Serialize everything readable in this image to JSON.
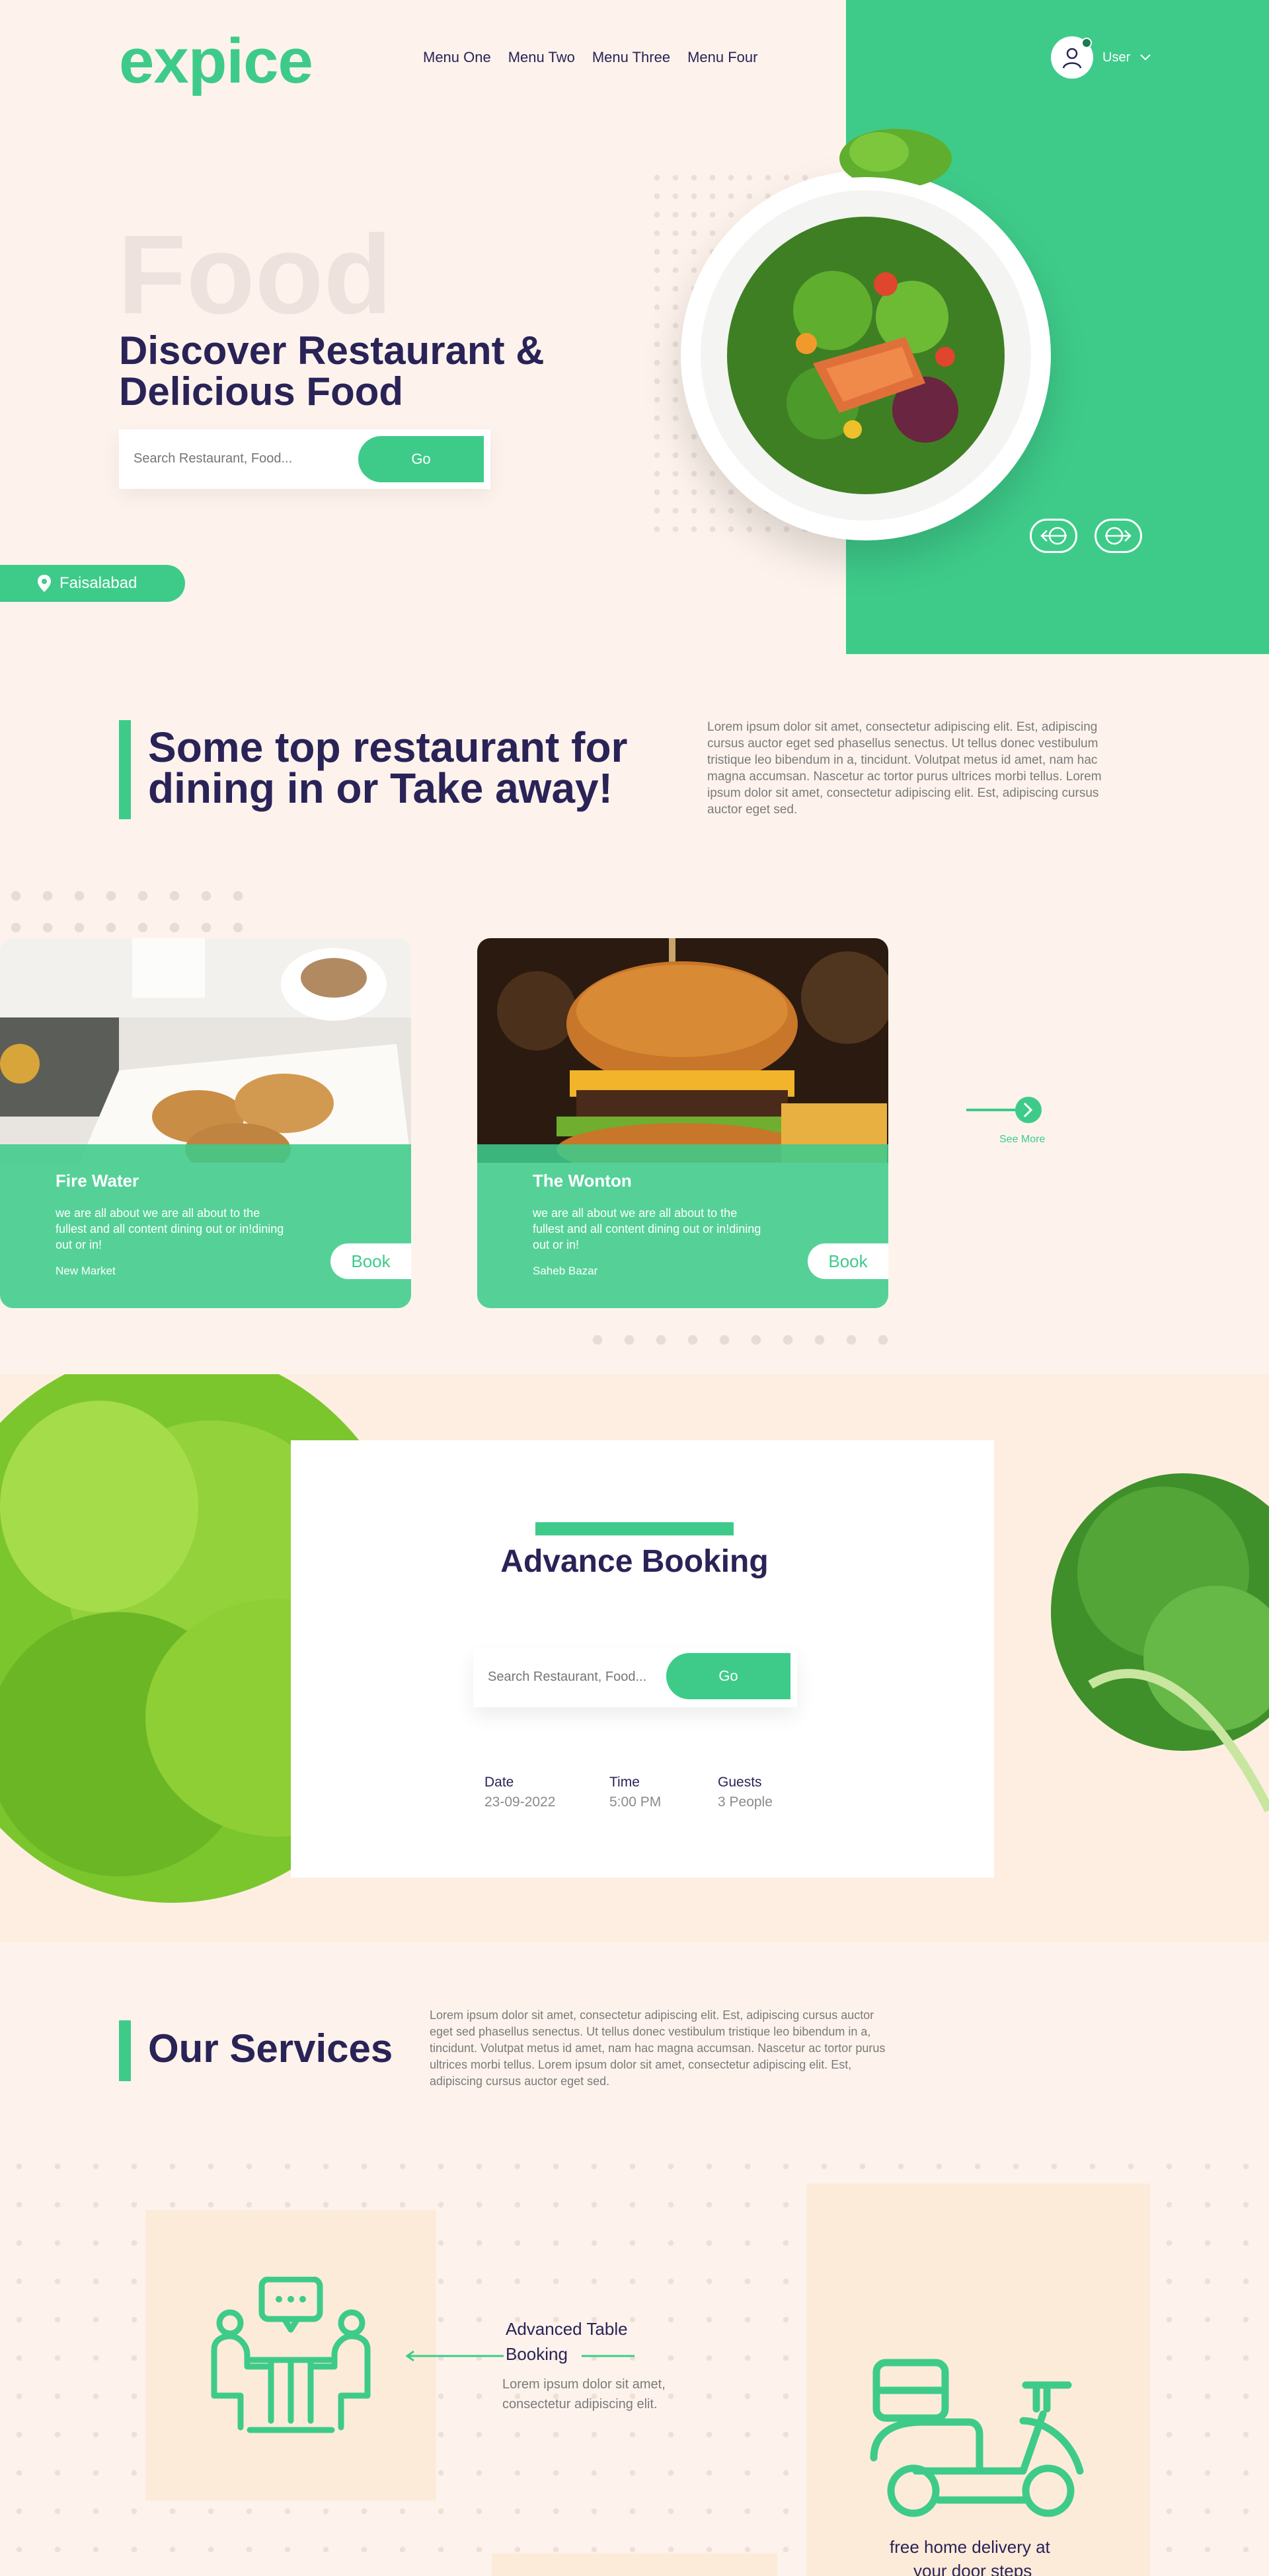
{
  "header": {
    "logo": "expice",
    "nav": [
      "Menu One",
      "Menu Two",
      "Menu Three",
      "Menu Four"
    ],
    "user_label": "User"
  },
  "hero": {
    "bg_word": "Food",
    "title": "Discover Restaurant & Delicious Food",
    "search_placeholder": "Search Restaurant, Food...",
    "go_label": "Go",
    "location": "Faisalabad"
  },
  "top": {
    "title": "Some top restaurant for dining in or Take away!",
    "description": "Lorem ipsum dolor sit amet, consectetur adipiscing elit. Est, adipiscing cursus auctor eget sed phasellus senectus. Ut tellus donec vestibulum tristique leo bibendum in a, tincidunt. Volutpat metus id amet, nam hac magna accumsan. Nascetur ac tortor purus ultrices morbi tellus. Lorem ipsum dolor sit amet, consectetur adipiscing elit. Est, adipiscing cursus auctor eget sed.",
    "cards": [
      {
        "name": "Fire Water",
        "description": "we are all about we are all about to the fullest and all content dining out or in!dining out or in!",
        "location": "New Market",
        "book_label": "Book"
      },
      {
        "name": "The Wonton",
        "description": "we are all about we are all about to the fullest and all content dining out or in!dining out or in!",
        "location": "Saheb Bazar",
        "book_label": "Book"
      }
    ],
    "see_more": "See More"
  },
  "booking": {
    "title": "Advance Booking",
    "search_placeholder": "Search Restaurant, Food...",
    "go_label": "Go",
    "fields": [
      {
        "label": "Date",
        "value": "23-09-2022"
      },
      {
        "label": "Time",
        "value": "5:00 PM"
      },
      {
        "label": "Guests",
        "value": "3 People"
      }
    ]
  },
  "services": {
    "title": "Our Services",
    "description": "Lorem ipsum dolor sit amet, consectetur adipiscing elit. Est, adipiscing cursus auctor eget sed phasellus senectus. Ut tellus donec vestibulum tristique leo bibendum in a, tincidunt. Volutpat metus id amet, nam hac magna accumsan. Nascetur ac tortor purus ultrices morbi tellus. Lorem ipsum dolor sit amet, consectetur adipiscing elit. Est, adipiscing cursus auctor eget sed.",
    "table_booking": {
      "title_line1": "Advanced Table",
      "title_line2": "Booking",
      "text": "Lorem ipsum dolor sit amet, consectetur adipiscing elit."
    },
    "delivery": {
      "title_line1": "free home delivery at",
      "title_line2": "your door steps"
    }
  },
  "colors": {
    "accent": "#3ecb8a",
    "navy": "#2a2357",
    "cream": "#fdf3ec",
    "peach": "#fdebd9"
  },
  "icons": [
    "user-icon",
    "chevron-down-icon",
    "location-pin-icon",
    "arrow-left-icon",
    "arrow-right-icon",
    "chevron-right-icon",
    "table-booking-icon",
    "delivery-scooter-icon"
  ]
}
